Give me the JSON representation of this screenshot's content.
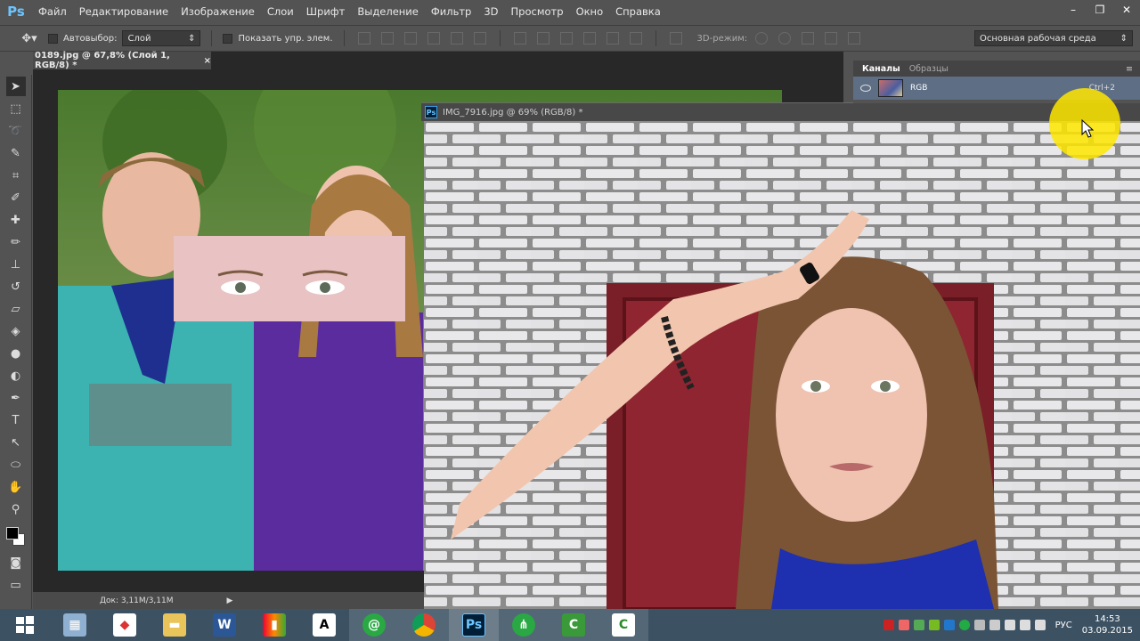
{
  "app": {
    "logo": "Ps"
  },
  "menu": [
    "Файл",
    "Редактирование",
    "Изображение",
    "Слои",
    "Шрифт",
    "Выделение",
    "Фильтр",
    "3D",
    "Просмотр",
    "Окно",
    "Справка"
  ],
  "window_controls": {
    "minimize": "–",
    "restore": "❐",
    "close": "✕"
  },
  "options": {
    "autoselect_label": "Автовыбор:",
    "autoselect_value": "Слой",
    "show_controls_label": "Показать упр. элем.",
    "mode3d_label": "3D-режим:",
    "workspace_value": "Основная рабочая среда"
  },
  "doc1": {
    "tab_title": "0189.jpg @ 67,8% (Слой 1, RGB/8) *",
    "tab_close": "×",
    "status": "Док: 3,11M/3,11M"
  },
  "doc2": {
    "title": "IMG_7916.jpg @ 69% (RGB/8) *"
  },
  "panel": {
    "tab_channels": "Каналы",
    "tab_swatches": "Образцы",
    "channel_name": "RGB",
    "channel_shortcut": "Ctrl+2"
  },
  "taskbar": {
    "apps": [
      "start",
      "calculator",
      "pdf-reader",
      "explorer",
      "word",
      "office",
      "font-viewer",
      "mail",
      "chrome",
      "photoshop",
      "network",
      "camtasia",
      "camtasia-recorder"
    ],
    "lang": "РУС",
    "time": "14:53",
    "date": "03.09.2015"
  },
  "colors": {
    "bg": "#535353",
    "panel_select": "#5d6e85",
    "highlight": "#ffe600",
    "taskbar": "#3c5263"
  }
}
